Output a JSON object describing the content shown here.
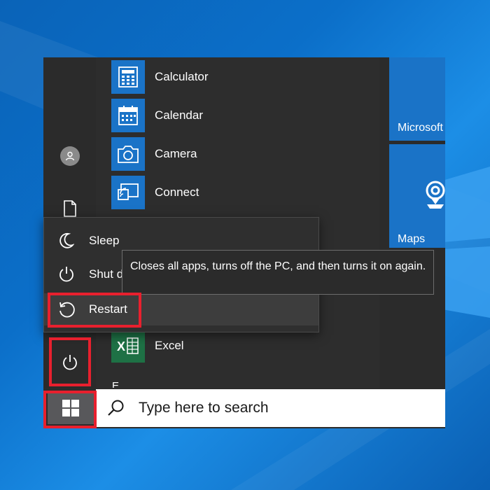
{
  "start_menu": {
    "apps": [
      {
        "label": "Calculator",
        "icon": "calculator-icon"
      },
      {
        "label": "Calendar",
        "icon": "calendar-icon"
      },
      {
        "label": "Camera",
        "icon": "camera-icon"
      },
      {
        "label": "Connect",
        "icon": "connect-icon"
      },
      {
        "label": "Excel",
        "icon": "excel-icon"
      }
    ],
    "section_letter": "E",
    "tiles": [
      {
        "label": "Microsoft"
      },
      {
        "label": "Maps",
        "icon": "maps-icon"
      }
    ]
  },
  "power_menu": {
    "items": [
      {
        "label": "Sleep",
        "icon": "sleep-icon"
      },
      {
        "label": "Shut d",
        "icon": "shutdown-icon"
      },
      {
        "label": "Restart",
        "icon": "restart-icon"
      }
    ],
    "tooltip": "Closes all apps, turns off the PC, and then turns it on again."
  },
  "taskbar": {
    "search_placeholder": "Type here to search"
  },
  "colors": {
    "accent": "#1a73c7",
    "highlight": "#e8202e",
    "menu_bg": "#2b2b2b"
  }
}
